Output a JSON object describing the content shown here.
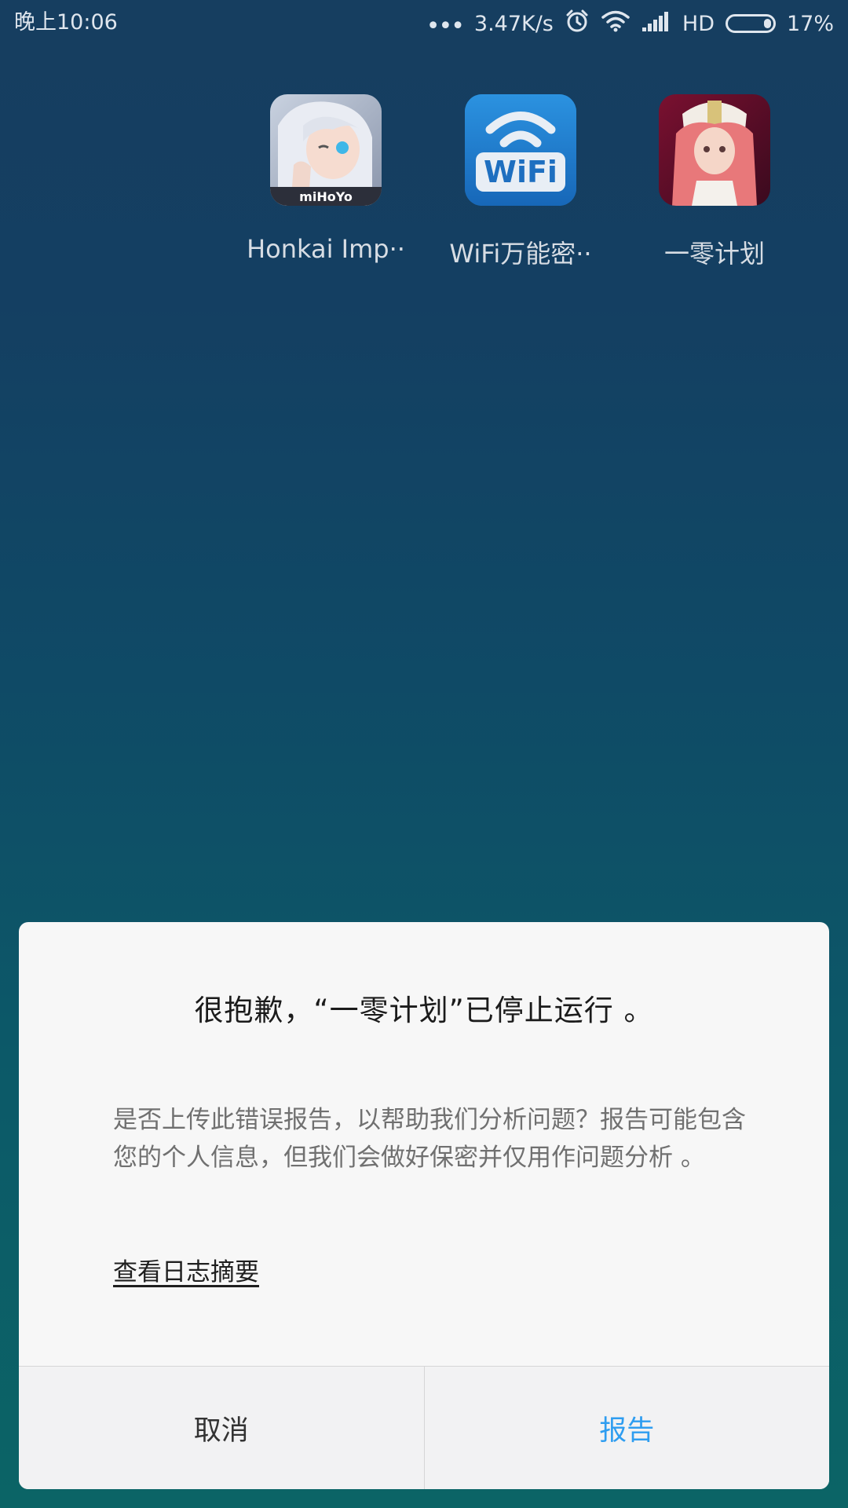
{
  "status_bar": {
    "time": "晚上10:06",
    "net_speed": "3.47K/s",
    "hd_label": "HD",
    "battery_percent": "17%",
    "battery_level": 0.17,
    "icons": [
      "more-dots-icon",
      "alarm-icon",
      "wifi-icon",
      "signal-icon",
      "battery-icon"
    ]
  },
  "apps": [
    {
      "label": "Honkai Imp··",
      "icon": "honkai-impact-app-icon",
      "brand_text": "miHoYo"
    },
    {
      "label": "WiFi万能密··",
      "icon": "wifi-master-app-icon",
      "brand_text": "WiFi"
    },
    {
      "label": "一零计划",
      "icon": "zero-plan-app-icon"
    }
  ],
  "dialog": {
    "title": "很抱歉，“一零计划”已停止运行 。",
    "message": "是否上传此错误报告，以帮助我们分析问题？报告可能包含您的个人信息，但我们会做好保密并仅用作问题分析 。",
    "view_log_link": "查看日志摘要",
    "cancel_label": "取消",
    "report_label": "报告"
  },
  "colors": {
    "accent_blue": "#2e9df0",
    "dialog_bg": "#f7f7f7",
    "wifi_icon_bg": "#1e7fd1"
  }
}
